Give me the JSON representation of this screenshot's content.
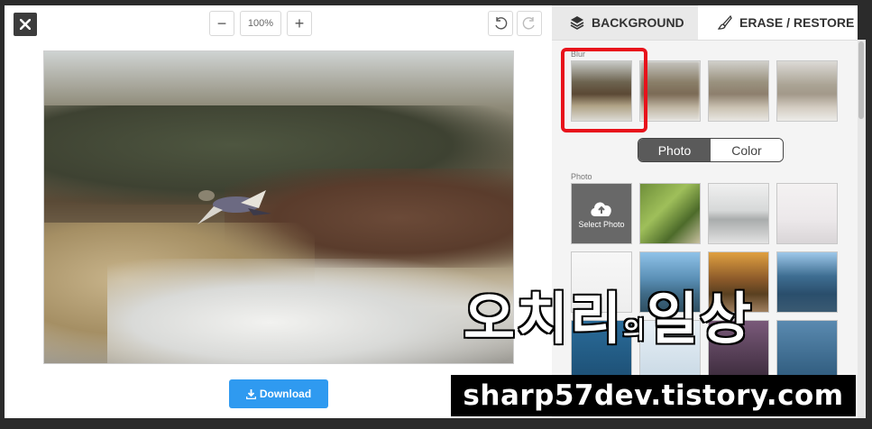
{
  "editor": {
    "zoom_minus": "−",
    "zoom_value": "100%",
    "zoom_plus": "+",
    "download_label": "Download"
  },
  "panel": {
    "tabs": [
      {
        "label": "BACKGROUND",
        "icon": "layers-icon",
        "active": true
      },
      {
        "label": "ERASE / RESTORE",
        "icon": "brush-icon",
        "active": false
      }
    ],
    "blur_label": "Blur",
    "toggle": {
      "photo": "Photo",
      "color": "Color",
      "selected": "Photo"
    },
    "photo_label": "Photo",
    "select_photo_label": "Select Photo"
  },
  "watermark": {
    "title_a": "오치리",
    "title_b": "의",
    "title_c": "일상",
    "url": "sharp57dev.tistory.com"
  },
  "colors": {
    "accent_blue": "#2f9af0",
    "highlight_red": "#e8121b",
    "toggle_dark": "#5a5a5a"
  }
}
